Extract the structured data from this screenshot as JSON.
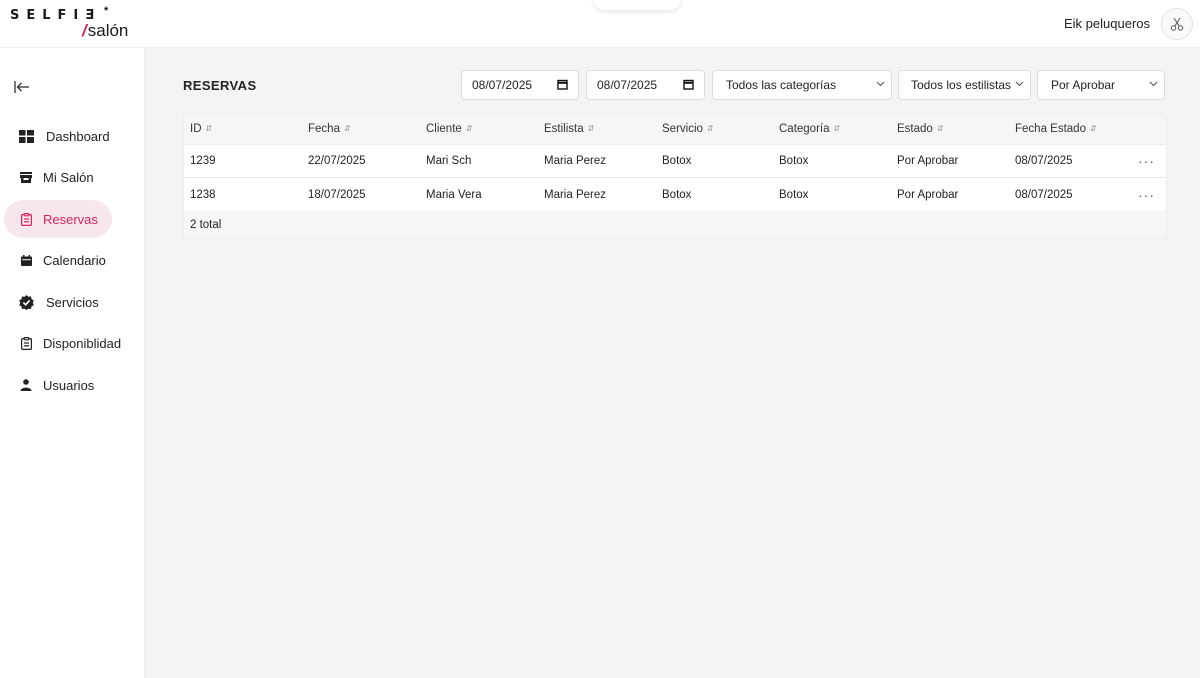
{
  "header": {
    "logo_top": "SELFI",
    "logo_e": "Ǝ",
    "logo_star": "*",
    "logo_slash": "/",
    "logo_bottom": "salón",
    "salon_name": "Eik peluqueros"
  },
  "sidebar": {
    "items": [
      {
        "label": "Dashboard",
        "icon": "dashboard-icon"
      },
      {
        "label": "Mi Salón",
        "icon": "store-icon"
      },
      {
        "label": "Reservas",
        "icon": "clipboard-icon",
        "active": true
      },
      {
        "label": "Calendario",
        "icon": "calendar-icon"
      },
      {
        "label": "Servicios",
        "icon": "verified-badge-icon"
      },
      {
        "label": "Disponiblidad",
        "icon": "clipboard-list-icon"
      },
      {
        "label": "Usuarios",
        "icon": "user-icon"
      }
    ]
  },
  "main": {
    "title": "RESERVAS",
    "filters": {
      "date_from": "08/07/2025",
      "date_to": "08/07/2025",
      "category": "Todos las categorías",
      "stylist": "Todos los estilistas",
      "status": "Por Aprobar"
    },
    "table": {
      "columns": [
        "ID",
        "Fecha",
        "Cliente",
        "Estilista",
        "Servicio",
        "Categoría",
        "Estado",
        "Fecha Estado"
      ],
      "rows": [
        [
          "1239",
          "22/07/2025",
          "Mari Sch",
          "Maria Perez",
          "Botox",
          "Botox",
          "Por Aprobar",
          "08/07/2025"
        ],
        [
          "1238",
          "18/07/2025",
          "Maria Vera",
          "Maria Perez",
          "Botox",
          "Botox",
          "Por Aprobar",
          "08/07/2025"
        ]
      ],
      "row_action": "···",
      "total": "2 total"
    }
  },
  "colors": {
    "accent": "#d6245f",
    "active_bg": "#f7e6ec",
    "page_bg": "#f4f4f5"
  }
}
